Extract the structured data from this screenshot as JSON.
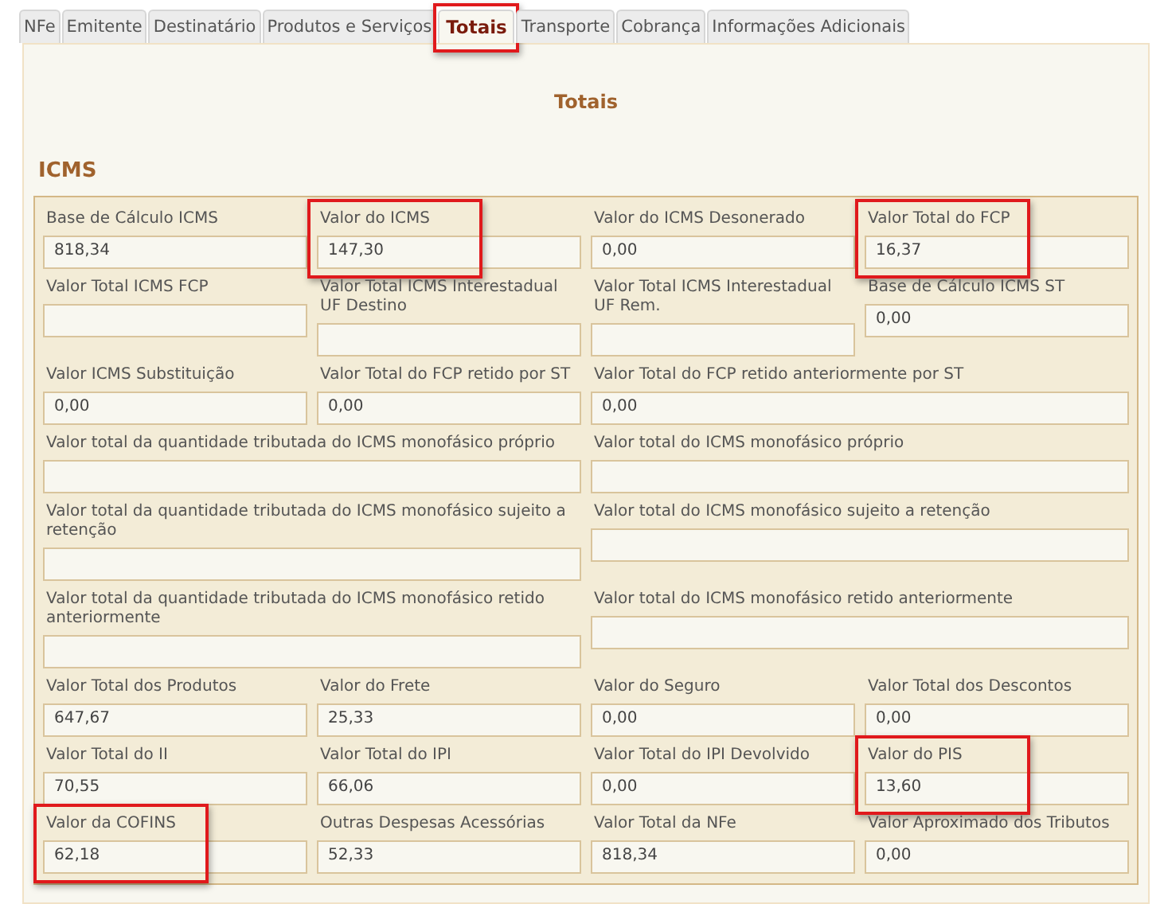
{
  "tabs": [
    {
      "label": "NFe",
      "selected": false,
      "highlighted": false
    },
    {
      "label": "Emitente",
      "selected": false,
      "highlighted": false
    },
    {
      "label": "Destinatário",
      "selected": false,
      "highlighted": false
    },
    {
      "label": "Produtos e Serviços",
      "selected": false,
      "highlighted": false
    },
    {
      "label": "Totais",
      "selected": true,
      "highlighted": true
    },
    {
      "label": "Transporte",
      "selected": false,
      "highlighted": false
    },
    {
      "label": "Cobrança",
      "selected": false,
      "highlighted": false
    },
    {
      "label": "Informações Adicionais",
      "selected": false,
      "highlighted": false
    }
  ],
  "heading": "Totais",
  "section": "ICMS",
  "fields": [
    {
      "kind": "quarter",
      "label": "Base de Cálculo ICMS",
      "value": "818,34",
      "highlighted": false
    },
    {
      "kind": "quarter",
      "label": "Valor do ICMS",
      "value": "147,30",
      "highlighted": true
    },
    {
      "kind": "quarter",
      "label": "Valor do ICMS Desonerado",
      "value": "0,00",
      "highlighted": false
    },
    {
      "kind": "quarter",
      "label": "Valor Total do FCP",
      "value": "16,37",
      "highlighted": true
    },
    {
      "kind": "quarter",
      "label": "Valor Total ICMS FCP",
      "highlighted": false
    },
    {
      "kind": "quarter",
      "label": "Valor Total ICMS Interestadual UF Destino",
      "highlighted": false
    },
    {
      "kind": "quarter",
      "label": "Valor Total ICMS Interestadual UF Rem.",
      "highlighted": false
    },
    {
      "kind": "quarter",
      "label": "Base de Cálculo ICMS ST",
      "value": "0,00",
      "highlighted": false
    },
    {
      "kind": "quarter",
      "label": "Valor ICMS Substituição",
      "value": "0,00",
      "highlighted": false
    },
    {
      "kind": "quarter",
      "label": "Valor Total do FCP retido por ST",
      "value": "0,00",
      "highlighted": false
    },
    {
      "kind": "half",
      "label": "Valor Total do FCP retido anteriormente por ST",
      "value": "0,00",
      "highlighted": false
    },
    {
      "kind": "half",
      "label": "Valor total da quantidade tributada do ICMS monofásico próprio",
      "highlighted": false
    },
    {
      "kind": "half",
      "label": "Valor total do ICMS monofásico próprio",
      "highlighted": false
    },
    {
      "kind": "half",
      "label": "Valor total da quantidade tributada do ICMS monofásico sujeito a retenção",
      "highlighted": false
    },
    {
      "kind": "half",
      "label": "Valor total do ICMS monofásico sujeito a retenção",
      "highlighted": false
    },
    {
      "kind": "half",
      "label": "Valor total da quantidade tributada do ICMS monofásico retido anteriormente",
      "highlighted": false
    },
    {
      "kind": "half",
      "label": "Valor total do ICMS monofásico retido anteriormente",
      "highlighted": false
    },
    {
      "kind": "quarter",
      "label": "Valor Total dos Produtos",
      "value": "647,67",
      "highlighted": false
    },
    {
      "kind": "quarter",
      "label": "Valor do Frete",
      "value": "25,33",
      "highlighted": false
    },
    {
      "kind": "quarter",
      "label": "Valor do Seguro",
      "value": "0,00",
      "highlighted": false
    },
    {
      "kind": "quarter",
      "label": "Valor Total dos Descontos",
      "value": "0,00",
      "highlighted": false
    },
    {
      "kind": "quarter",
      "label": "Valor Total do II",
      "value": "70,55",
      "highlighted": false
    },
    {
      "kind": "quarter",
      "label": "Valor Total do IPI",
      "value": "66,06",
      "highlighted": false
    },
    {
      "kind": "quarter",
      "label": "Valor Total do IPI Devolvido",
      "value": "0,00",
      "highlighted": false
    },
    {
      "kind": "quarter",
      "label": "Valor do PIS",
      "value": "13,60",
      "highlighted": true
    },
    {
      "kind": "quarter",
      "label": "Valor da COFINS",
      "value": "62,18",
      "highlighted": true
    },
    {
      "kind": "quarter",
      "label": "Outras Despesas Acessórias",
      "value": "52,33",
      "highlighted": false
    },
    {
      "kind": "quarter",
      "label": "Valor Total da NFe",
      "value": "818,34",
      "highlighted": false
    },
    {
      "kind": "quarter",
      "label": "Valor Aproximado dos Tributos",
      "value": "0,00",
      "highlighted": false
    }
  ]
}
